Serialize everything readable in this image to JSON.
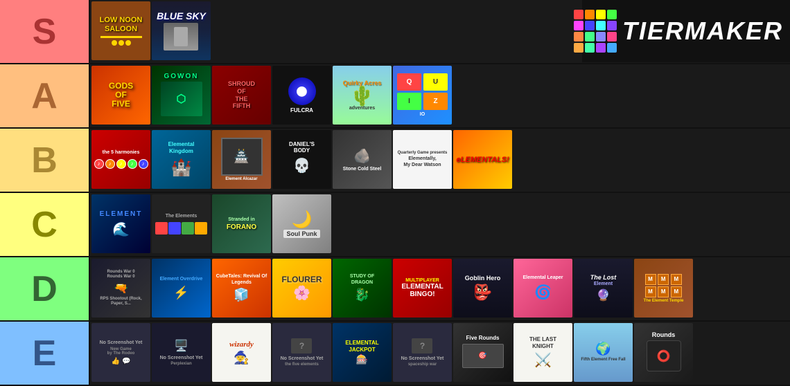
{
  "logo": {
    "title": "TIERMAKER",
    "grid_colors": [
      "#ff4444",
      "#ff8800",
      "#ffff00",
      "#44ff44",
      "#4444ff",
      "#8844ff",
      "#ff44ff",
      "#44ffff",
      "#ff8844",
      "#44ff88",
      "#8888ff",
      "#ff4488",
      "#ffaa44",
      "#44ffaa",
      "#aa44ff",
      "#44aaff"
    ]
  },
  "tiers": [
    {
      "id": "S",
      "label": "S",
      "bg": "#ff7f7f",
      "games": [
        {
          "id": "low-noon",
          "title": "LOW NOON\nSALOON",
          "bg": "#8B4513",
          "text_color": "#FFD700",
          "has_image": true
        },
        {
          "id": "blue-sky",
          "title": "BLUE SKY",
          "bg": "#1a1a2e",
          "text_color": "white",
          "has_image": true
        }
      ]
    },
    {
      "id": "A",
      "label": "A",
      "bg": "#ffbf7f",
      "games": [
        {
          "id": "gods-of-five",
          "title": "GODS OF FIVE",
          "bg": "#ff6600",
          "text_color": "white"
        },
        {
          "id": "gowon",
          "title": "GOWON",
          "bg": "#004422",
          "text_color": "#00ff88"
        },
        {
          "id": "shroud",
          "title": "SHROUD OF THE FIFTH",
          "bg": "#8B0000",
          "text_color": "white"
        },
        {
          "id": "fulcra",
          "title": "FULCRA",
          "bg": "#1a1a2e",
          "text_color": "white"
        },
        {
          "id": "quirky-acres",
          "title": "Quirky Acres",
          "bg": "#87CEEB",
          "text_color": "#333"
        },
        {
          "id": "quizio",
          "title": "quizio",
          "bg": "#4169E1",
          "text_color": "white"
        }
      ]
    },
    {
      "id": "B",
      "label": "B",
      "bg": "#ffdf7f",
      "games": [
        {
          "id": "5-harmonies",
          "title": "The 5 Harmonies",
          "bg": "#cc0000",
          "text_color": "white"
        },
        {
          "id": "elemental-kingdom",
          "title": "Elemental Kingdom",
          "bg": "#006699",
          "text_color": "white"
        },
        {
          "id": "element-alcazar",
          "title": "Element Alcazar",
          "bg": "#8B4513",
          "text_color": "white"
        },
        {
          "id": "daniels-body",
          "title": "DANIEL'S BODY",
          "bg": "#111",
          "text_color": "white"
        },
        {
          "id": "stone-cold",
          "title": "Stone Cold Steel",
          "bg": "#444",
          "text_color": "white"
        },
        {
          "id": "elementally",
          "title": "Elementally, My Dear Watson",
          "bg": "#f5f5f5",
          "text_color": "#333"
        },
        {
          "id": "elementals",
          "title": "eLEMENTALS",
          "bg": "#ff6600",
          "text_color": "white"
        }
      ]
    },
    {
      "id": "C",
      "label": "C",
      "bg": "#ffff7f",
      "games": [
        {
          "id": "element-c",
          "title": "ELEMENT",
          "bg": "#003366",
          "text_color": "white"
        },
        {
          "id": "the-elements",
          "title": "The Elements",
          "bg": "#222",
          "text_color": "white"
        },
        {
          "id": "stranded",
          "title": "Stranded in FORANO",
          "bg": "#1a472a",
          "text_color": "white"
        },
        {
          "id": "soul-punk",
          "title": "Soul Punk",
          "bg": "#c0c0c0",
          "text_color": "#333"
        }
      ]
    },
    {
      "id": "D",
      "label": "D",
      "bg": "#7fff7f",
      "games": [
        {
          "id": "rps-shootout",
          "title": "RPS Shootout",
          "bg": "#1a1a2e",
          "text_color": "white"
        },
        {
          "id": "element-overdrive",
          "title": "Element Overdrive",
          "bg": "#003366",
          "text_color": "white"
        },
        {
          "id": "cubetales",
          "title": "CubeTales: Revival Of Legends",
          "bg": "#ff6600",
          "text_color": "white"
        },
        {
          "id": "flourer",
          "title": "FLOURER",
          "bg": "#ffcc00",
          "text_color": "#333"
        },
        {
          "id": "study-of-dragon",
          "title": "STUDY OF DRAGON",
          "bg": "#006600",
          "text_color": "white"
        },
        {
          "id": "elemental-bingo",
          "title": "ELEMENTAL BINGO",
          "bg": "#cc0000",
          "text_color": "white"
        },
        {
          "id": "goblin-hero",
          "title": "Goblin Hero",
          "bg": "#1a1a2e",
          "text_color": "white"
        },
        {
          "id": "elemental-leaper",
          "title": "Elemental Leaper",
          "bg": "#ff6699",
          "text_color": "white"
        },
        {
          "id": "the-lost",
          "title": "The Lost Element",
          "bg": "#1a1a2e",
          "text_color": "white"
        },
        {
          "id": "element-temple",
          "title": "The Element Temple",
          "bg": "#8B4513",
          "text_color": "white"
        }
      ]
    },
    {
      "id": "E",
      "label": "E",
      "bg": "#7fbfff",
      "games": [
        {
          "id": "no-screenshot-1",
          "title": "No Screenshot Yet",
          "sub": "New Game",
          "bg": "#2a2a3e",
          "text_color": "white"
        },
        {
          "id": "perplexian",
          "title": "No Screenshot Yet",
          "sub": "Perplexian",
          "bg": "#1a1a2e",
          "text_color": "white"
        },
        {
          "id": "wizardy",
          "title": "wizardy",
          "sub": "",
          "bg": "#f5f5f0",
          "text_color": "#cc3300"
        },
        {
          "id": "no-screenshot-2",
          "title": "No Screenshot Yet",
          "sub": "the five elements",
          "bg": "#2a2a3e",
          "text_color": "white"
        },
        {
          "id": "elemental-jackpot",
          "title": "ELEMENTAL JACKPOT",
          "bg": "#003366",
          "text_color": "white"
        },
        {
          "id": "no-screenshot-3",
          "title": "No Screenshot Yet",
          "sub": "spaceship war",
          "bg": "#2a2a3e",
          "text_color": "white"
        },
        {
          "id": "five-rounds",
          "title": "Five Rounds",
          "sub": "",
          "bg": "#333",
          "text_color": "white"
        },
        {
          "id": "the-last-knight",
          "title": "THE LAST KNIGHT",
          "bg": "#f5f5f0",
          "text_color": "#333"
        },
        {
          "id": "fifth-element",
          "title": "Fifth Element Free Fall",
          "bg": "#87CEEB",
          "text_color": "#333"
        },
        {
          "id": "rounds",
          "title": "Rounds",
          "bg": "#222",
          "text_color": "white"
        }
      ]
    }
  ]
}
